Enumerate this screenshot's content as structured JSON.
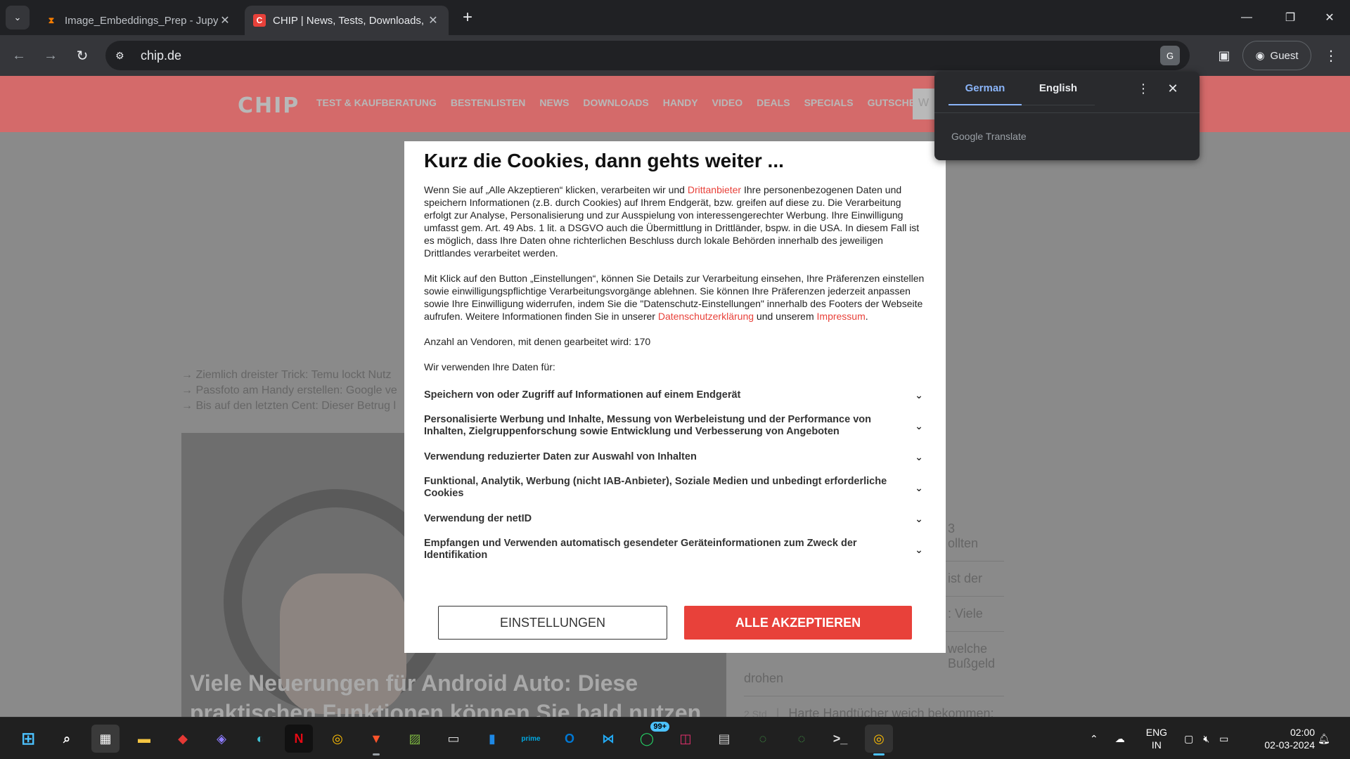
{
  "browser": {
    "tabs": [
      {
        "title": "Image_Embeddings_Prep - Jupy",
        "active": false
      },
      {
        "title": "CHIP | News, Tests, Downloads,",
        "active": true
      }
    ],
    "url": "chip.de",
    "profile_label": "Guest"
  },
  "site": {
    "logo": "CHIP",
    "nav": [
      "TEST & KAUFBERATUNG",
      "BESTENLISTEN",
      "NEWS",
      "DOWNLOADS",
      "HANDY",
      "VIDEO",
      "DEALS",
      "SPECIALS",
      "GUTSCHEINE"
    ],
    "search_placeholder": "W",
    "links": [
      "→ Ziemlich dreister Trick: Temu lockt Nutz",
      "→ Passfoto am Handy erstellen: Google ve",
      "→ Bis auf den letzten Cent: Dieser Betrug l"
    ],
    "hero_headline": "Viele Neuerungen für Android Auto: Diese praktischen Funktionen können Sie bald nutzen",
    "side_items": [
      {
        "text": "3",
        "tail": "ollten"
      },
      {
        "text": "ist der",
        "tail": ""
      },
      {
        "text": ": Viele",
        "tail": ""
      },
      {
        "text": "welche",
        "tail": "Bußgeld"
      },
      {
        "text": "drohen",
        "tail": ""
      }
    ],
    "bottom_item_time": "2 Std",
    "bottom_item_text": "Harte Handtücher weich bekommen: Das hilft"
  },
  "cookie_modal": {
    "title": "Kurz die Cookies, dann gehts weiter ...",
    "para1_a": "Wenn Sie auf „Alle Akzeptieren“ klicken, verarbeiten wir und ",
    "para1_link": "Drittanbieter",
    "para1_b": " Ihre personenbezogenen Daten und speichern Informationen (z.B. durch Cookies) auf Ihrem Endgerät, bzw. greifen auf diese zu. Die Verarbeitung erfolgt zur Analyse, Personalisierung und zur Ausspielung von interessengerechter Werbung. Ihre Einwilligung umfasst gem. Art. 49 Abs. 1 lit. a DSGVO auch die Übermittlung in Drittländer, bspw. in die USA. In diesem Fall ist es möglich, dass Ihre Daten ohne richterlichen Beschluss durch lokale Behörden innerhalb des jeweiligen Drittlandes verarbeitet werden.",
    "para2_a": "Mit Klick auf den Button „Einstellungen“, können Sie Details zur Verarbeitung einsehen, Ihre Präferenzen einstellen sowie einwilligungspflichtige Verarbeitungsvorgänge ablehnen. Sie können Ihre Präferenzen jederzeit anpassen sowie Ihre Einwilligung widerrufen, indem Sie die \"Datenschutz-Einstellungen\" innerhalb des Footers der Webseite aufrufen. Weitere Informationen finden Sie in unserer ",
    "para2_link1": "Datenschutzerklärung",
    "para2_mid": " und unserem ",
    "para2_link2": "Impressum",
    "para2_end": ".",
    "vendors": "Anzahl an Vendoren, mit denen gearbeitet wird: 170",
    "purposes_intro": "Wir verwenden Ihre Daten für:",
    "purposes": [
      "Speichern von oder Zugriff auf Informationen auf einem Endgerät",
      "Personalisierte Werbung und Inhalte, Messung von Werbeleistung und der Performance von Inhalten, Zielgruppenforschung sowie Entwicklung und Verbesserung von Angeboten",
      "Verwendung reduzierter Daten zur Auswahl von Inhalten",
      "Funktional, Analytik, Werbung (nicht IAB-Anbieter), Soziale Medien und unbedingt erforderliche Cookies",
      "Verwendung der netID",
      "Empfangen und Verwenden automatisch gesendeter Geräteinformationen zum Zweck der Identifikation"
    ],
    "settings_label": "EINSTELLUNGEN",
    "accept_label": "ALLE AKZEPTIEREN"
  },
  "translate_popup": {
    "tab_source": "German",
    "tab_target": "English",
    "brand": "Google Translate"
  },
  "taskbar": {
    "badge": "99+",
    "lang_line1": "ENG",
    "lang_line2": "IN",
    "time": "02:00",
    "date": "02-03-2024"
  },
  "colors": {
    "accent_red": "#e8413a",
    "chrome_dark": "#202124",
    "translate_blue": "#8ab4f8"
  }
}
